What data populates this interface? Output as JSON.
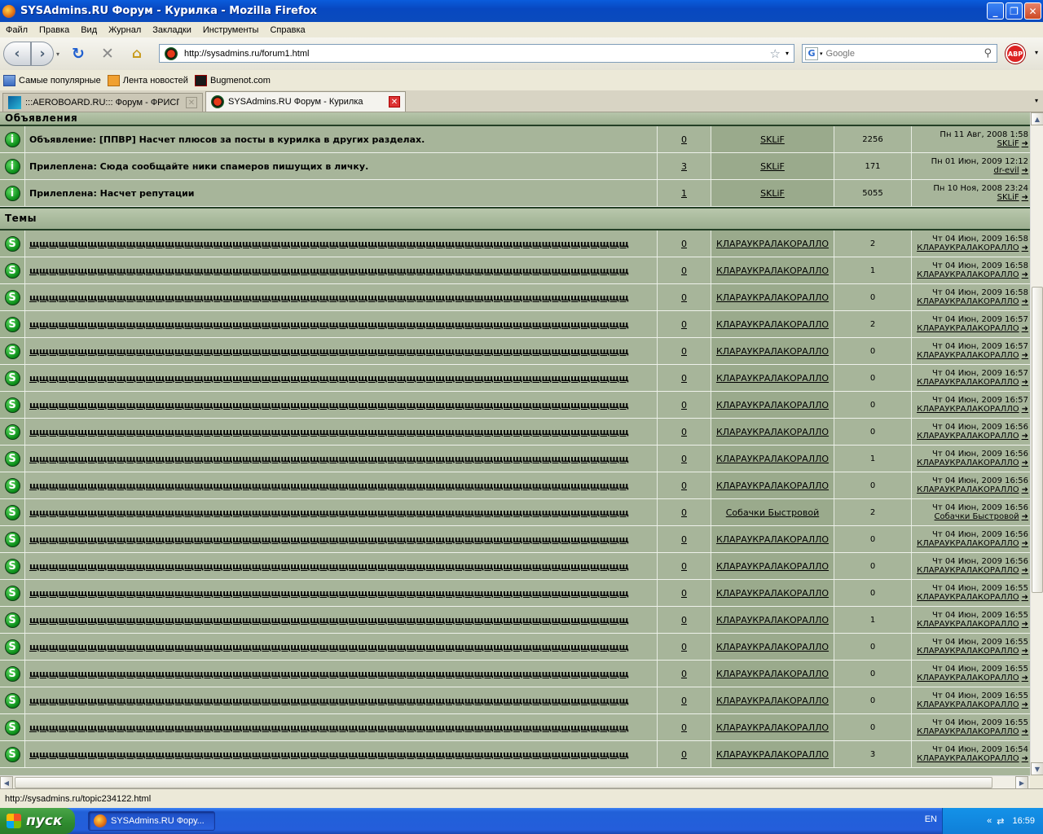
{
  "window": {
    "title": "SYSAdmins.RU Форум - Курилка - Mozilla Firefox"
  },
  "menu": [
    "Файл",
    "Правка",
    "Вид",
    "Журнал",
    "Закладки",
    "Инструменты",
    "Справка"
  ],
  "nav": {
    "url": "http://sysadmins.ru/forum1.html",
    "search_placeholder": "Google",
    "abp": "ABP"
  },
  "bookmarks": [
    "Самые популярные",
    "Лента новостей",
    "Bugmenot.com"
  ],
  "tabs": [
    {
      "label": ":::AEROBOARD.RU::: Форум - ФРИСП...",
      "active": false
    },
    {
      "label": "SYSAdmins.RU Форум - Курилка",
      "active": true
    }
  ],
  "sections": {
    "announcements": "Объявления",
    "topics": "Темы"
  },
  "announcements": [
    {
      "title": "Объявление: [ППВР] Насчет плюсов за посты в курилка в других разделах.",
      "replies": "0",
      "author": "SKLiF",
      "views": "2256",
      "last_date": "Пн 11 Авг, 2008 1:58",
      "last_user": "SKLiF"
    },
    {
      "title": "Прилеплена: Сюда сообщайте ники спамеров пишущих в личку.",
      "replies": "3",
      "author": "SKLiF",
      "views": "171",
      "last_date": "Пн 01 Июн, 2009 12:12",
      "last_user": "dr-evil"
    },
    {
      "title": "Прилеплена: Насчет репутации",
      "replies": "1",
      "author": "SKLiF",
      "views": "5055",
      "last_date": "Пн 10 Ноя, 2008 23:24",
      "last_user": "SKLiF"
    }
  ],
  "topics": [
    {
      "title": "щщщщщщщщщщщщщщщщщщщщщщщщщщщщщщщщщщщщщщщщщщщщщщщщщщщщщщщщщщщщщщ",
      "replies": "0",
      "author": "КЛАРАУКРАЛАКОРАЛЛО",
      "views": "2",
      "last_date": "Чт 04 Июн, 2009 16:58",
      "last_user": "КЛАРАУКРАЛАКОРАЛЛО"
    },
    {
      "title": "щщщщщщщщщщщщщщщщщщщщщщщщщщщщщщщщщщщщщщщщщщщщщщщщщщщщщщщщщщщщщщ",
      "replies": "0",
      "author": "КЛАРАУКРАЛАКОРАЛЛО",
      "views": "1",
      "last_date": "Чт 04 Июн, 2009 16:58",
      "last_user": "КЛАРАУКРАЛАКОРАЛЛО"
    },
    {
      "title": "щщщщщщщщщщщщщщщщщщщщщщщщщщщщщщщщщщщщщщщщщщщщщщщщщщщщщщщщщщщщщщ",
      "replies": "0",
      "author": "КЛАРАУКРАЛАКОРАЛЛО",
      "views": "0",
      "last_date": "Чт 04 Июн, 2009 16:58",
      "last_user": "КЛАРАУКРАЛАКОРАЛЛО"
    },
    {
      "title": "щщщщщщщщщщщщщщщщщщщщщщщщщщщщщщщщщщщщщщщщщщщщщщщщщщщщщщщщщщщщщщ",
      "replies": "0",
      "author": "КЛАРАУКРАЛАКОРАЛЛО",
      "views": "2",
      "last_date": "Чт 04 Июн, 2009 16:57",
      "last_user": "КЛАРАУКРАЛАКОРАЛЛО"
    },
    {
      "title": "щщщщщщщщщщщщщщщщщщщщщщщщщщщщщщщщщщщщщщщщщщщщщщщщщщщщщщщщщщщщщщ",
      "replies": "0",
      "author": "КЛАРАУКРАЛАКОРАЛЛО",
      "views": "0",
      "last_date": "Чт 04 Июн, 2009 16:57",
      "last_user": "КЛАРАУКРАЛАКОРАЛЛО"
    },
    {
      "title": "щщщщщщщщщщщщщщщщщщщщщщщщщщщщщщщщщщщщщщщщщщщщщщщщщщщщщщщщщщщщщщ",
      "replies": "0",
      "author": "КЛАРАУКРАЛАКОРАЛЛО",
      "views": "0",
      "last_date": "Чт 04 Июн, 2009 16:57",
      "last_user": "КЛАРАУКРАЛАКОРАЛЛО"
    },
    {
      "title": "щщщщщщщщщщщщщщщщщщщщщщщщщщщщщщщщщщщщщщщщщщщщщщщщщщщщщщщщщщщщщщ",
      "replies": "0",
      "author": "КЛАРАУКРАЛАКОРАЛЛО",
      "views": "0",
      "last_date": "Чт 04 Июн, 2009 16:57",
      "last_user": "КЛАРАУКРАЛАКОРАЛЛО"
    },
    {
      "title": "щщщщщщщщщщщщщщщщщщщщщщщщщщщщщщщщщщщщщщщщщщщщщщщщщщщщщщщщщщщщщщ",
      "replies": "0",
      "author": "КЛАРАУКРАЛАКОРАЛЛО",
      "views": "0",
      "last_date": "Чт 04 Июн, 2009 16:56",
      "last_user": "КЛАРАУКРАЛАКОРАЛЛО"
    },
    {
      "title": "щщщщщщщщщщщщщщщщщщщщщщщщщщщщщщщщщщщщщщщщщщщщщщщщщщщщщщщщщщщщщщ",
      "replies": "0",
      "author": "КЛАРАУКРАЛАКОРАЛЛО",
      "views": "1",
      "last_date": "Чт 04 Июн, 2009 16:56",
      "last_user": "КЛАРАУКРАЛАКОРАЛЛО"
    },
    {
      "title": "щщщщщщщщщщщщщщщщщщщщщщщщщщщщщщщщщщщщщщщщщщщщщщщщщщщщщщщщщщщщщщ",
      "replies": "0",
      "author": "КЛАРАУКРАЛАКОРАЛЛО",
      "views": "0",
      "last_date": "Чт 04 Июн, 2009 16:56",
      "last_user": "КЛАРАУКРАЛАКОРАЛЛО"
    },
    {
      "title": "щщщщщщщщщщщщщщщщщщщщщщщщщщщщщщщщщщщщщщщщщщщщщщщщщщщщщщщщщщщщщщ",
      "replies": "0",
      "author": "Собачки Быстровой",
      "views": "2",
      "last_date": "Чт 04 Июн, 2009 16:56",
      "last_user": "Собачки Быстровой"
    },
    {
      "title": "щщщщщщщщщщщщщщщщщщщщщщщщщщщщщщщщщщщщщщщщщщщщщщщщщщщщщщщщщщщщщщ",
      "replies": "0",
      "author": "КЛАРАУКРАЛАКОРАЛЛО",
      "views": "0",
      "last_date": "Чт 04 Июн, 2009 16:56",
      "last_user": "КЛАРАУКРАЛАКОРАЛЛО"
    },
    {
      "title": "щщщщщщщщщщщщщщщщщщщщщщщщщщщщщщщщщщщщщщщщщщщщщщщщщщщщщщщщщщщщщщ",
      "replies": "0",
      "author": "КЛАРАУКРАЛАКОРАЛЛО",
      "views": "0",
      "last_date": "Чт 04 Июн, 2009 16:56",
      "last_user": "КЛАРАУКРАЛАКОРАЛЛО"
    },
    {
      "title": "щщщщщщщщщщщщщщщщщщщщщщщщщщщщщщщщщщщщщщщщщщщщщщщщщщщщщщщщщщщщщщ",
      "replies": "0",
      "author": "КЛАРАУКРАЛАКОРАЛЛО",
      "views": "0",
      "last_date": "Чт 04 Июн, 2009 16:55",
      "last_user": "КЛАРАУКРАЛАКОРАЛЛО"
    },
    {
      "title": "щщщщщщщщщщщщщщщщщщщщщщщщщщщщщщщщщщщщщщщщщщщщщщщщщщщщщщщщщщщщщщ",
      "replies": "0",
      "author": "КЛАРАУКРАЛАКОРАЛЛО",
      "views": "1",
      "last_date": "Чт 04 Июн, 2009 16:55",
      "last_user": "КЛАРАУКРАЛАКОРАЛЛО"
    },
    {
      "title": "щщщщщщщщщщщщщщщщщщщщщщщщщщщщщщщщщщщщщщщщщщщщщщщщщщщщщщщщщщщщщщ",
      "replies": "0",
      "author": "КЛАРАУКРАЛАКОРАЛЛО",
      "views": "0",
      "last_date": "Чт 04 Июн, 2009 16:55",
      "last_user": "КЛАРАУКРАЛАКОРАЛЛО"
    },
    {
      "title": "щщщщщщщщщщщщщщщщщщщщщщщщщщщщщщщщщщщщщщщщщщщщщщщщщщщщщщщщщщщщщщ",
      "replies": "0",
      "author": "КЛАРАУКРАЛАКОРАЛЛО",
      "views": "0",
      "last_date": "Чт 04 Июн, 2009 16:55",
      "last_user": "КЛАРАУКРАЛАКОРАЛЛО"
    },
    {
      "title": "щщщщщщщщщщщщщщщщщщщщщщщщщщщщщщщщщщщщщщщщщщщщщщщщщщщщщщщщщщщщщщ",
      "replies": "0",
      "author": "КЛАРАУКРАЛАКОРАЛЛО",
      "views": "0",
      "last_date": "Чт 04 Июн, 2009 16:55",
      "last_user": "КЛАРАУКРАЛАКОРАЛЛО"
    },
    {
      "title": "щщщщщщщщщщщщщщщщщщщщщщщщщщщщщщщщщщщщщщщщщщщщщщщщщщщщщщщщщщщщщщ",
      "replies": "0",
      "author": "КЛАРАУКРАЛАКОРАЛЛО",
      "views": "0",
      "last_date": "Чт 04 Июн, 2009 16:55",
      "last_user": "КЛАРАУКРАЛАКОРАЛЛО"
    },
    {
      "title": "щщщщщщщщщщщщщщщщщщщщщщщщщщщщщщщщщщщщщщщщщщщщщщщщщщщщщщщщщщщщщщ",
      "replies": "0",
      "author": "КЛАРАУКРАЛАКОРАЛЛО",
      "views": "3",
      "last_date": "Чт 04 Июн, 2009 16:54",
      "last_user": "КЛАРАУКРАЛАКОРАЛЛО"
    }
  ],
  "status": {
    "text": "http://sysadmins.ru/topic234122.html"
  },
  "taskbar": {
    "start": "пуск",
    "item": "SYSAdmins.RU Фору...",
    "lang": "EN",
    "clock": "16:59"
  },
  "icons": {
    "announcement": "info-icon",
    "topic": "topic-s-icon",
    "last_post": "go-to-post-icon"
  },
  "colors": {
    "content_bg": "#a7b59a",
    "header_border": "#244026",
    "titlebar": "#0a5cdc",
    "taskbar": "#245edb",
    "start": "#2e8a2e"
  }
}
